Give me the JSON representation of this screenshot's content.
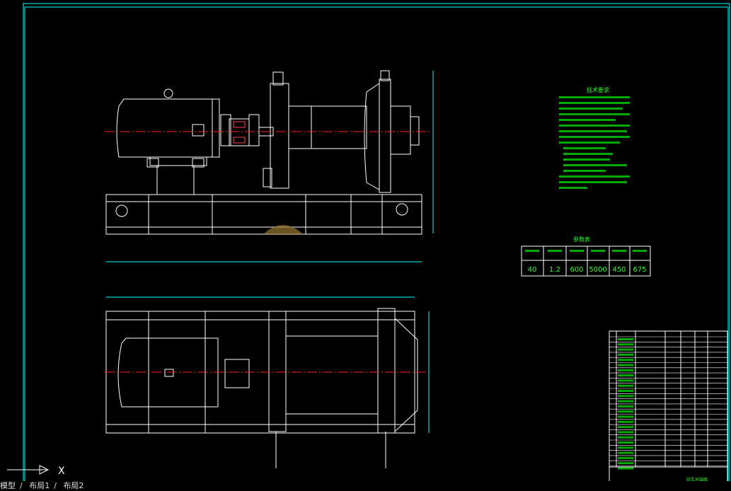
{
  "window": {
    "tabs": [
      "模型",
      "布局1",
      "布局2"
    ],
    "tabs_separator": "/"
  },
  "leaders_top": [
    "1",
    "2",
    "3",
    "4",
    "5",
    "6",
    "7",
    "8",
    "9",
    "10",
    "11",
    "12",
    "13",
    "14",
    "15",
    "16",
    "17",
    "18",
    "19",
    "20",
    "21",
    "22",
    "23",
    "24",
    "25",
    "26",
    "27"
  ],
  "tech_requirements": {
    "title": "技术要求"
  },
  "params_table": {
    "title": "参数表",
    "values": [
      "40",
      "1.2",
      "600",
      "5000",
      "450",
      "675"
    ]
  },
  "parts_list": {
    "title_block_name": "绞车总装图"
  },
  "ucs": {
    "x_label": "X"
  },
  "colors": {
    "background": "#000000",
    "geometry": "#ffffff",
    "frame": "#00ffff",
    "centerline": "#ff2020",
    "text": "#22ff22"
  }
}
